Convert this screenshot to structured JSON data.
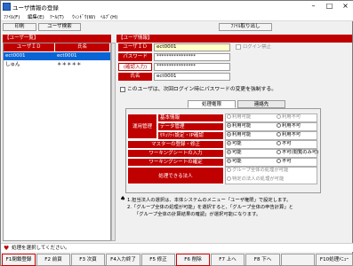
{
  "window": {
    "title": "ユーザ情報の登録"
  },
  "menu": [
    "ﾌｧｲﾙ(F)",
    "編集(E)",
    "ﾂｰﾙ(T)",
    "ｳｨﾝﾄﾞｳ(W)",
    "ﾍﾙﾌﾟ(H)"
  ],
  "toolbar": {
    "print": "印刷",
    "user_search": "ユーザ検索",
    "file_import": "ﾌｧｲﾙ取り出し"
  },
  "left": {
    "title": "【ユーザ一覧】",
    "col_id": "ユーザＩＤ",
    "col_name": "氏名",
    "rows": [
      {
        "id": "ect0001",
        "name": "ect0001",
        "selected": true
      },
      {
        "id": "しゅん",
        "name": "＊＊＊＊＊",
        "selected": false
      }
    ]
  },
  "right": {
    "title": "【ユーザ情報】",
    "user_id_label": "ユーザＩＤ",
    "user_id_value": "ect0001",
    "login_ban": "ログイン禁止",
    "password_label": "パスワード",
    "password_value": "****************",
    "confirm_label": "(確認入力)",
    "confirm_value": "****************",
    "name_label": "氏名",
    "name_value": "ect0001",
    "change_pw_text": "このユーザは、次回ログイン時にパスワードの変更を強制する。"
  },
  "tabs": {
    "permissions": "処理権限",
    "contact": "連絡先"
  },
  "perm": {
    "cat_ops": "運用管理",
    "basic_info": "基本情報",
    "data_mgmt": "データ管理",
    "security": "ｾｷｭﾘﾃｨ設定・IP確認",
    "master": "マスターの登録・修正",
    "ws_input": "ワーキングシートの入力",
    "ws_confirm": "ワーキングシートの確定",
    "corp": "処理できる法人",
    "allow": "利用可能",
    "deny": "利用不可",
    "can": "可能",
    "cannot": "不可",
    "cannot_view": "不可(閲覧のみ可)",
    "corp_all": "グループ全体の処理が可能",
    "corp_specific": "特定の法人の処理が可能"
  },
  "notes": [
    "1.担当法人の選択は、本体システムのメニュー「ユーザ権限」で設定します。",
    "2.「グループ全体の処理が可能」を選択すると、「グループ全体の申告計算」と",
    "「グループ全体の計算結果の確認」が選択可能になります。"
  ],
  "status": {
    "message": "処理を選択してください。"
  },
  "fkeys": [
    {
      "label": "F1閉鎖登録",
      "active": true
    },
    {
      "label": "F2 前頁",
      "active": false
    },
    {
      "label": "F3 次頁",
      "active": false
    },
    {
      "label": "F4入力終了",
      "active": false
    },
    {
      "label": "F5 修正",
      "active": false
    },
    {
      "label": "F6 削除",
      "active": true
    },
    {
      "label": "F7 上へ",
      "active": false
    },
    {
      "label": "F8 下へ",
      "active": false
    },
    {
      "label": "",
      "active": false
    },
    {
      "label": "F10処理ﾒﾆｭｰ",
      "active": false
    }
  ],
  "colors": {
    "accent_red": "#c00000",
    "selection_blue": "#0a64d4",
    "input_yellow": "#ffffc8"
  },
  "icons": [
    "app-icon",
    "minimize-icon",
    "maximize-icon",
    "close-icon",
    "heart-icon",
    "spade-icon"
  ]
}
